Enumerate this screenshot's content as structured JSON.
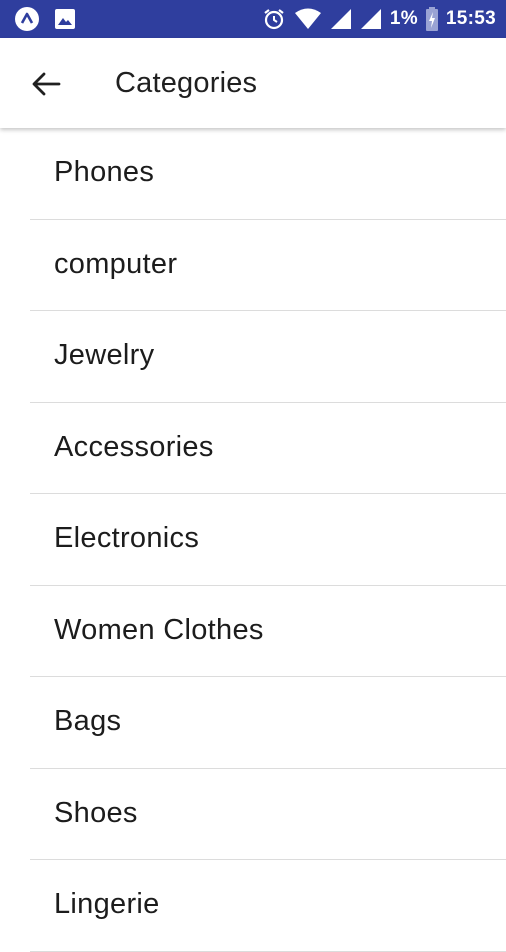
{
  "status_bar": {
    "battery": "1%",
    "time": "15:53",
    "icons": [
      "app-icon",
      "image-icon",
      "alarm-icon",
      "wifi-icon",
      "signal-icon",
      "signal-icon",
      "battery-charging-icon"
    ]
  },
  "app_bar": {
    "title": "Categories",
    "back_icon": "arrow-back-icon"
  },
  "categories": [
    {
      "label": "Phones"
    },
    {
      "label": "computer"
    },
    {
      "label": "Jewelry"
    },
    {
      "label": "Accessories"
    },
    {
      "label": "Electronics"
    },
    {
      "label": "Women Clothes"
    },
    {
      "label": "Bags"
    },
    {
      "label": "Shoes"
    },
    {
      "label": "Lingerie"
    }
  ],
  "colors": {
    "status_bar": "#2f3e9e",
    "background": "#ffffff",
    "divider": "#dcdcdc",
    "text": "#1c1c1c"
  }
}
